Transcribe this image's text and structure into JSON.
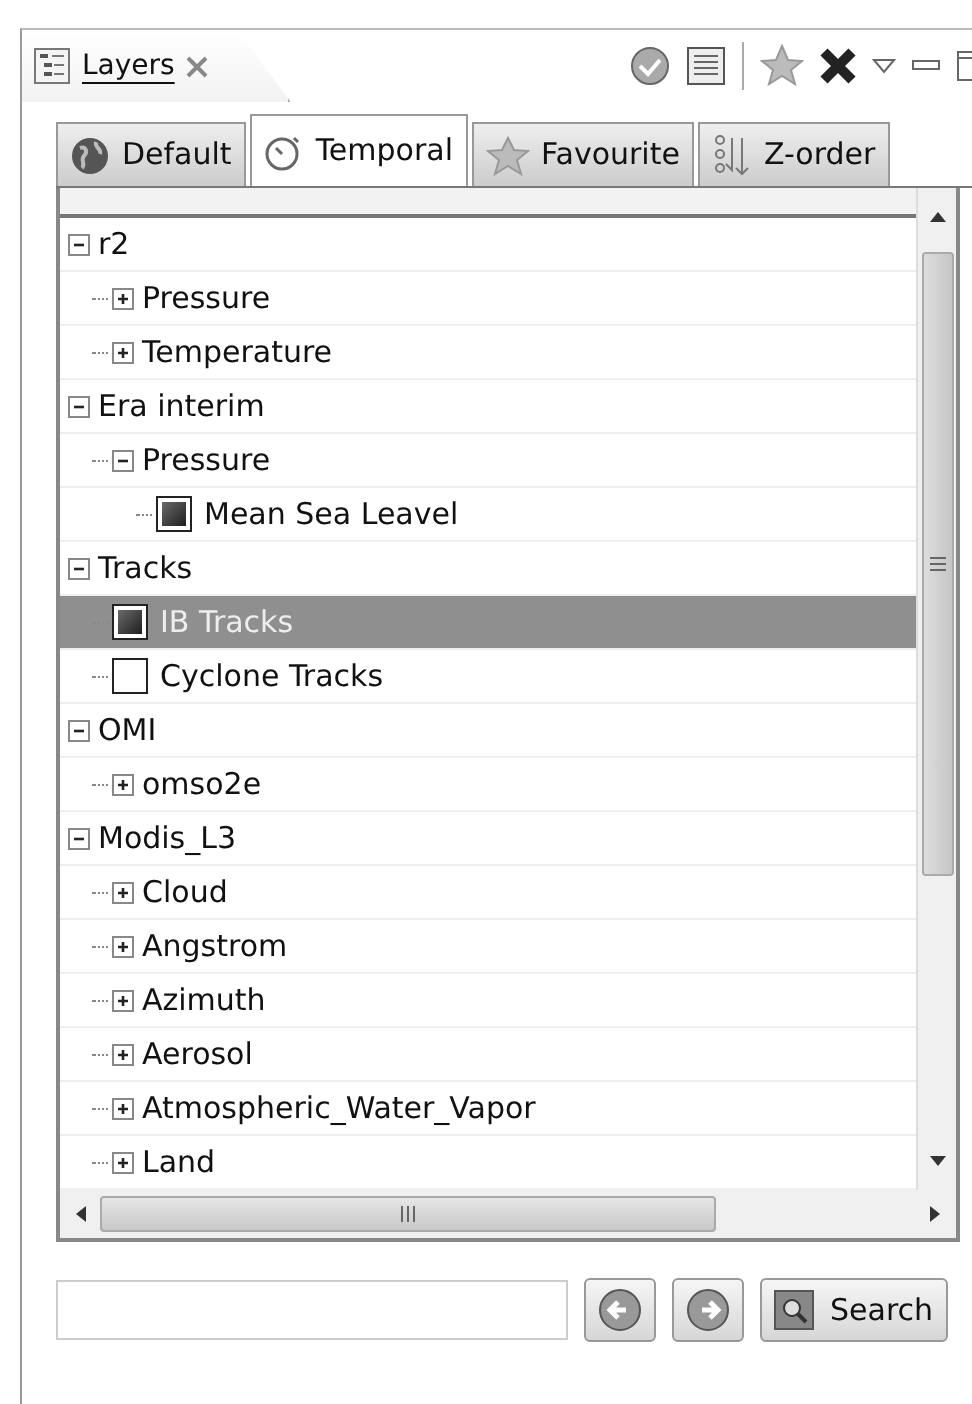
{
  "view": {
    "title": "Layers"
  },
  "tabs": [
    {
      "label": "Default",
      "selected": false,
      "kind": "globe"
    },
    {
      "label": "Temporal",
      "selected": true,
      "kind": "timer"
    },
    {
      "label": "Favourite",
      "selected": false,
      "kind": "star"
    },
    {
      "label": "Z-order",
      "selected": false,
      "kind": "order"
    }
  ],
  "tree": [
    {
      "label": "r2",
      "kind": "group",
      "expanded": true,
      "selected": false,
      "children": [
        {
          "label": "Pressure",
          "kind": "group",
          "expanded": false,
          "selected": false
        },
        {
          "label": "Temperature",
          "kind": "group",
          "expanded": false,
          "selected": false
        }
      ]
    },
    {
      "label": "Era interim",
      "kind": "group",
      "expanded": true,
      "selected": false,
      "children": [
        {
          "label": "Pressure",
          "kind": "group",
          "expanded": true,
          "selected": false,
          "children": [
            {
              "label": "Mean Sea Leavel",
              "kind": "layer",
              "checked": true,
              "selected": false
            }
          ]
        }
      ]
    },
    {
      "label": "Tracks",
      "kind": "group",
      "expanded": true,
      "selected": false,
      "children": [
        {
          "label": "IB Tracks",
          "kind": "layer",
          "checked": true,
          "selected": true
        },
        {
          "label": "Cyclone Tracks",
          "kind": "layer",
          "checked": false,
          "selected": false
        }
      ]
    },
    {
      "label": "OMI",
      "kind": "group",
      "expanded": true,
      "selected": false,
      "children": [
        {
          "label": "omso2e",
          "kind": "group",
          "expanded": false,
          "selected": false
        }
      ]
    },
    {
      "label": "Modis_L3",
      "kind": "group",
      "expanded": true,
      "selected": false,
      "children": [
        {
          "label": "Cloud",
          "kind": "group",
          "expanded": false,
          "selected": false
        },
        {
          "label": "Angstrom",
          "kind": "group",
          "expanded": false,
          "selected": false
        },
        {
          "label": "Azimuth",
          "kind": "group",
          "expanded": false,
          "selected": false
        },
        {
          "label": "Aerosol",
          "kind": "group",
          "expanded": false,
          "selected": false
        },
        {
          "label": "Atmospheric_Water_Vapor",
          "kind": "group",
          "expanded": false,
          "selected": false
        },
        {
          "label": "Land",
          "kind": "group",
          "expanded": false,
          "selected": false
        }
      ]
    }
  ],
  "search": {
    "button": "Search"
  }
}
